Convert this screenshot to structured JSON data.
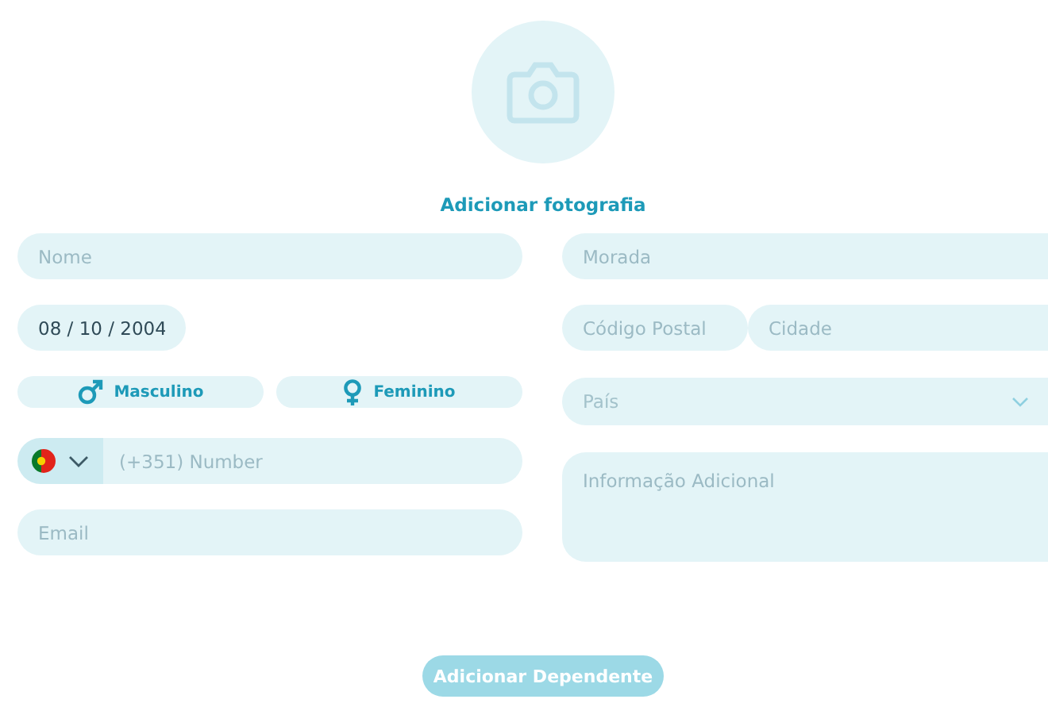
{
  "photo": {
    "label": "Adicionar fotografia"
  },
  "left": {
    "name": {
      "placeholder": "Nome"
    },
    "birthdate": {
      "value": "08 / 10 / 2004"
    },
    "genders": [
      {
        "kind": "male",
        "label": "Masculino",
        "selected": false
      },
      {
        "kind": "female",
        "label": "Feminino",
        "selected": false
      }
    ],
    "phone": {
      "placeholder": "(+351) Number"
    },
    "email": {
      "placeholder": "Email"
    }
  },
  "right": {
    "address": {
      "placeholder": "Morada"
    },
    "postal_code": {
      "placeholder": "Código Postal"
    },
    "city": {
      "placeholder": "Cidade"
    },
    "country": {
      "placeholder": "País",
      "disabled": true
    },
    "notes": {
      "placeholder": "Informação Adicional"
    }
  },
  "submit": {
    "label": "Adicionar Dependente"
  }
}
